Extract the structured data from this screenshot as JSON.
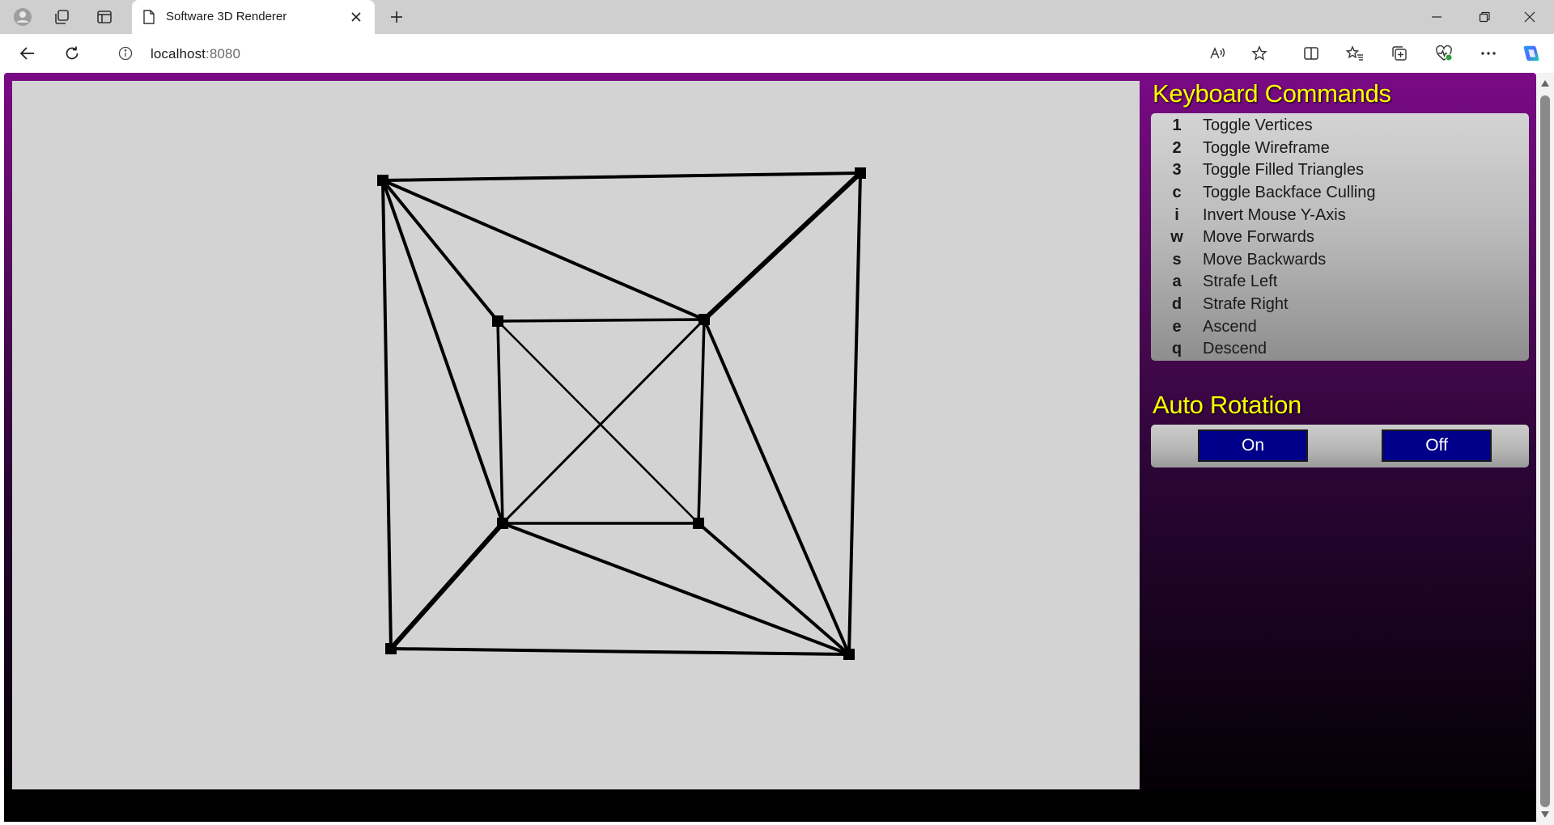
{
  "browser": {
    "tab_title": "Software 3D Renderer",
    "url_host": "localhost",
    "url_port": ":8080"
  },
  "icons": {
    "profile": "profile-icon",
    "workspaces": "workspaces-icon",
    "tab_actions": "tab-actions-icon",
    "page": "page-icon",
    "close": "close-icon",
    "new_tab": "plus-icon",
    "minimize": "minimize-icon",
    "restore": "restore-icon",
    "close_window": "close-icon",
    "back": "back-arrow-icon",
    "refresh": "refresh-icon",
    "info": "info-icon",
    "read_aloud": "read-aloud-icon",
    "favorite": "star-icon",
    "split_screen": "split-screen-icon",
    "favorites": "favorites-icon",
    "collections": "collections-icon",
    "browser_essentials": "heart-pulse-icon",
    "more": "more-icon",
    "copilot": "copilot-icon"
  },
  "panel": {
    "keyboard_heading": "Keyboard Commands",
    "commands": [
      {
        "key": "1",
        "label": "Toggle Vertices"
      },
      {
        "key": "2",
        "label": "Toggle Wireframe"
      },
      {
        "key": "3",
        "label": "Toggle Filled Triangles"
      },
      {
        "key": "c",
        "label": "Toggle Backface Culling"
      },
      {
        "key": "i",
        "label": "Invert Mouse Y-Axis"
      },
      {
        "key": "w",
        "label": "Move Forwards"
      },
      {
        "key": "s",
        "label": "Move Backwards"
      },
      {
        "key": "a",
        "label": "Strafe Left"
      },
      {
        "key": "d",
        "label": "Strafe Right"
      },
      {
        "key": "e",
        "label": "Ascend"
      },
      {
        "key": "q",
        "label": "Descend"
      }
    ],
    "rotation_heading": "Auto Rotation",
    "on_label": "On",
    "off_label": "Off"
  },
  "colors": {
    "heading": "#ffff00",
    "button_bg": "#00008b",
    "canvas_bg": "#d3d3d3",
    "page_top": "#7a0a86"
  }
}
